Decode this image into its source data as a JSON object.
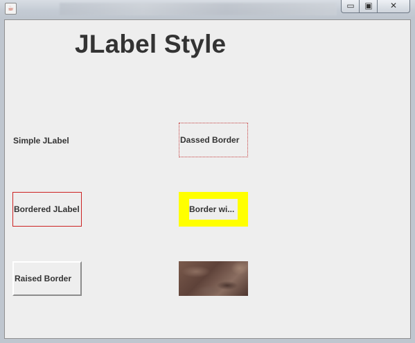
{
  "window": {
    "controls": {
      "minimize": "▭",
      "maximize": "▣",
      "close": "✕"
    },
    "icon": "java-icon"
  },
  "heading": "JLabel Style",
  "labels": {
    "simple": "Simple JLabel",
    "dashed": "Dassed Border",
    "bordered": "Bordered JLabel",
    "yellow": "Border wi...",
    "raised": "Raised Border"
  },
  "colors": {
    "background": "#eeeeee",
    "text": "#333333",
    "border_red": "#cc2222",
    "matte_yellow": "#ffff00"
  }
}
